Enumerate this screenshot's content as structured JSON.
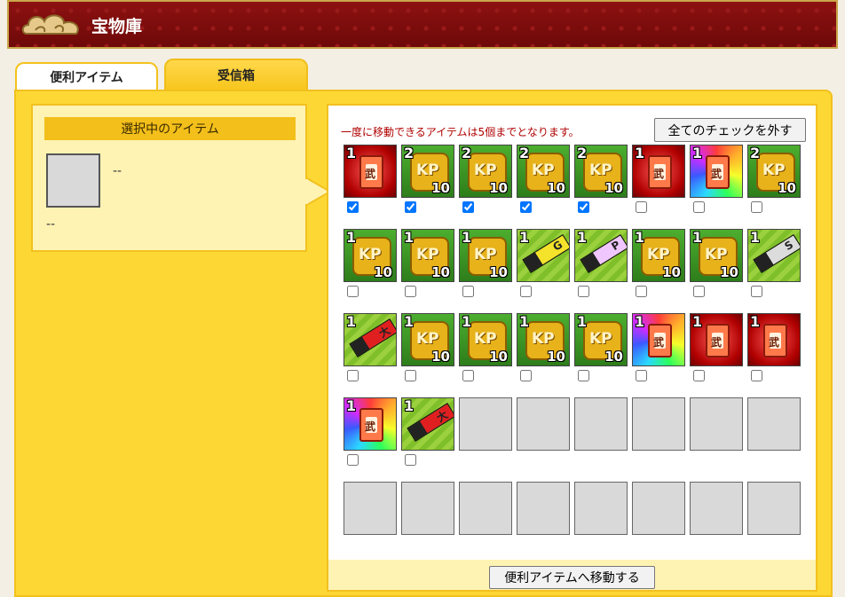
{
  "header": {
    "title": "宝物庫"
  },
  "tabs": [
    {
      "label": "便利アイテム"
    },
    {
      "label": "受信箱"
    }
  ],
  "detail": {
    "heading": "選択中のアイテム",
    "item_name": "--",
    "item_description": "--"
  },
  "panel": {
    "notice": "一度に移動できるアイテムは5個までとなります。",
    "uncheck_all_label": "全てのチェックを外す",
    "move_label": "便利アイテムへ移動する"
  },
  "colors": {
    "header_red": "#8d1111",
    "accent_yellow": "#fdd835",
    "notice_red": "#b00000"
  },
  "items": [
    {
      "icon": "red-war-card-icon",
      "qty": "1",
      "checked": true
    },
    {
      "icon": "kp-coin-10-icon",
      "qty": "2",
      "checked": true
    },
    {
      "icon": "kp-coin-10-icon",
      "qty": "2",
      "checked": true
    },
    {
      "icon": "kp-coin-10-icon",
      "qty": "2",
      "checked": true
    },
    {
      "icon": "kp-coin-10-icon",
      "qty": "2",
      "checked": true
    },
    {
      "icon": "red-war-card-icon",
      "qty": "1",
      "checked": false
    },
    {
      "icon": "rainbow-war-card-icon",
      "qty": "1",
      "checked": false
    },
    {
      "icon": "kp-coin-10-icon",
      "qty": "2",
      "checked": false
    },
    {
      "icon": "kp-coin-10-icon",
      "qty": "1",
      "checked": false
    },
    {
      "icon": "kp-coin-10-icon",
      "qty": "1",
      "checked": false
    },
    {
      "icon": "kp-coin-10-icon",
      "qty": "1",
      "checked": false
    },
    {
      "icon": "g-ticket-icon",
      "qty": "1",
      "checked": false
    },
    {
      "icon": "p-ticket-icon",
      "qty": "1",
      "checked": false
    },
    {
      "icon": "kp-coin-10-icon",
      "qty": "1",
      "checked": false
    },
    {
      "icon": "kp-coin-10-icon",
      "qty": "1",
      "checked": false
    },
    {
      "icon": "s-ticket-icon",
      "qty": "1",
      "checked": false
    },
    {
      "icon": "red-ticket-icon",
      "qty": "1",
      "checked": false
    },
    {
      "icon": "kp-coin-10-icon",
      "qty": "1",
      "checked": false
    },
    {
      "icon": "kp-coin-10-icon",
      "qty": "1",
      "checked": false
    },
    {
      "icon": "kp-coin-10-icon",
      "qty": "1",
      "checked": false
    },
    {
      "icon": "kp-coin-10-icon",
      "qty": "1",
      "checked": false
    },
    {
      "icon": "rainbow-war-card-icon",
      "qty": "1",
      "checked": false
    },
    {
      "icon": "red-war-card-icon",
      "qty": "1",
      "checked": false
    },
    {
      "icon": "red-war-card-icon",
      "qty": "1",
      "checked": false
    },
    {
      "icon": "rainbow-war-card-icon",
      "qty": "1",
      "checked": false
    },
    {
      "icon": "red-ticket-icon",
      "qty": "1",
      "checked": false
    },
    {
      "icon": "empty-slot",
      "qty": "",
      "checked": null
    },
    {
      "icon": "empty-slot",
      "qty": "",
      "checked": null
    },
    {
      "icon": "empty-slot",
      "qty": "",
      "checked": null
    },
    {
      "icon": "empty-slot",
      "qty": "",
      "checked": null
    },
    {
      "icon": "empty-slot",
      "qty": "",
      "checked": null
    },
    {
      "icon": "empty-slot",
      "qty": "",
      "checked": null
    },
    {
      "icon": "empty-slot",
      "qty": "",
      "checked": null
    },
    {
      "icon": "empty-slot",
      "qty": "",
      "checked": null
    },
    {
      "icon": "empty-slot",
      "qty": "",
      "checked": null
    },
    {
      "icon": "empty-slot",
      "qty": "",
      "checked": null
    },
    {
      "icon": "empty-slot",
      "qty": "",
      "checked": null
    },
    {
      "icon": "empty-slot",
      "qty": "",
      "checked": null
    },
    {
      "icon": "empty-slot",
      "qty": "",
      "checked": null
    },
    {
      "icon": "empty-slot",
      "qty": "",
      "checked": null
    }
  ],
  "glyphs": {
    "war": "武",
    "kp": "KP",
    "ten": "10",
    "g": "G",
    "p": "P",
    "s": "S",
    "big": "大"
  }
}
